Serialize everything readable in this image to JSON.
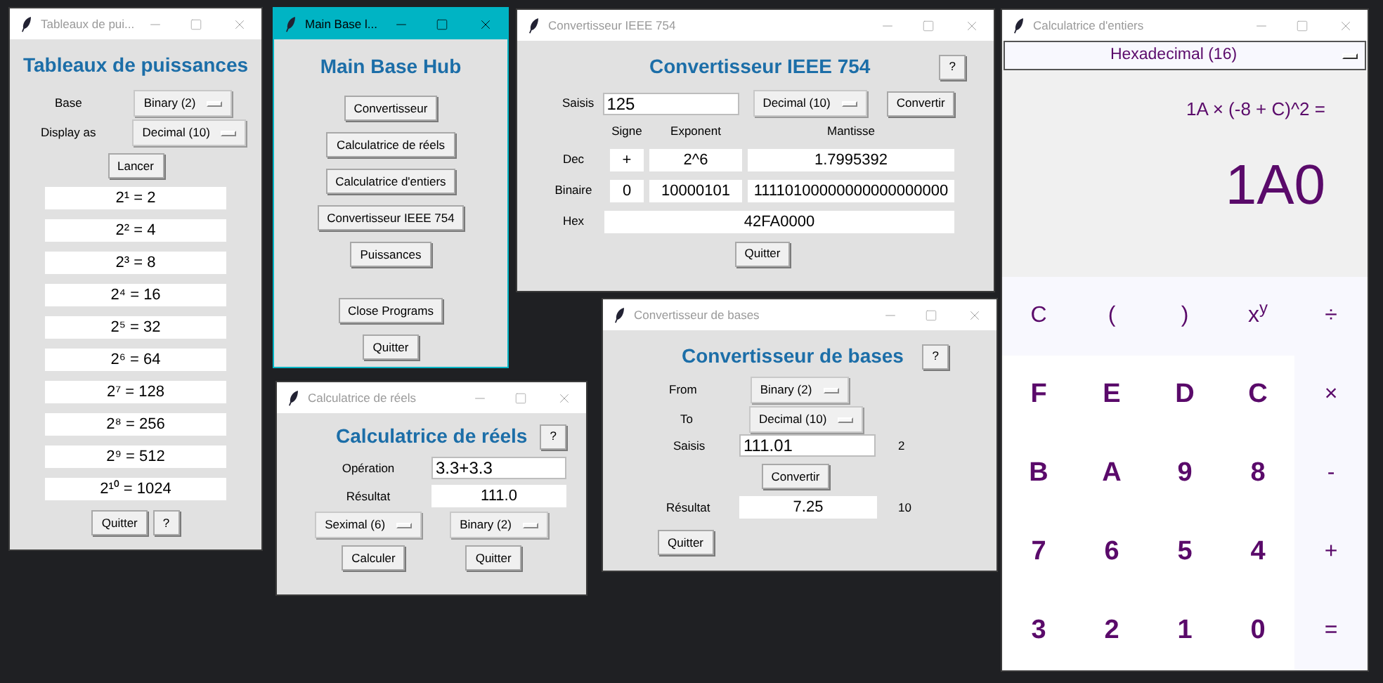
{
  "windows": [
    {
      "kind": "powers",
      "title": "Tableaux de pui...",
      "active": false,
      "heading": "Tableaux de puissances",
      "selectors": [
        {
          "label": "Base",
          "value": "Binary (2)"
        },
        {
          "label": "Display as",
          "value": "Decimal (10)"
        }
      ],
      "run_button": "Lancer",
      "results": [
        "2¹ = 2",
        "2² = 4",
        "2³ = 8",
        "2⁴ = 16",
        "2⁵ = 32",
        "2⁶ = 64",
        "2⁷ = 128",
        "2⁸ = 256",
        "2⁹ = 512",
        "2¹⁰ = 1024"
      ],
      "buttons": [
        "Quitter",
        "?"
      ]
    },
    {
      "kind": "hub",
      "title": "Main Base l...",
      "active": true,
      "heading": "Main Base Hub",
      "buttons": [
        "Convertisseur",
        "Calculatrice de réels",
        "Calculatrice d'entiers",
        "Convertisseur IEEE 754",
        "Puissances"
      ],
      "bottom_buttons": [
        "Close Programs",
        "Quitter"
      ]
    },
    {
      "kind": "reals",
      "title": "Calculatrice de réels",
      "active": false,
      "heading": "Calculatrice de réels",
      "help_button": "?",
      "operation": {
        "label": "Opération",
        "value": "3.3+3.3"
      },
      "result": {
        "label": "Résultat",
        "value": "111.0"
      },
      "selectors": [
        "Seximal (6)",
        "Binary (2)"
      ],
      "buttons": [
        "Calculer",
        "Quitter"
      ]
    },
    {
      "kind": "ieee",
      "title": "Convertisseur IEEE 754",
      "active": false,
      "heading": "Convertisseur IEEE 754",
      "help_button": "?",
      "input": {
        "label": "Saisis",
        "value": "125"
      },
      "selector": "Decimal (10)",
      "convert_button": "Convertir",
      "columns": [
        "Signe",
        "Exponent",
        "Mantisse"
      ],
      "rows": [
        {
          "label": "Dec",
          "cells": [
            "+",
            "2^6",
            "1.7995392"
          ]
        },
        {
          "label": "Binaire",
          "cells": [
            "0",
            "10000101",
            "11110100000000000000000"
          ]
        }
      ],
      "hex": {
        "label": "Hex",
        "value": "42FA0000"
      },
      "quit_button": "Quitter"
    },
    {
      "kind": "bases",
      "title": "Convertisseur de bases",
      "active": false,
      "heading": "Convertisseur de bases",
      "help_button": "?",
      "from": {
        "label": "From",
        "value": "Binary (2)"
      },
      "to": {
        "label": "To",
        "value": "Decimal (10)"
      },
      "input": {
        "label": "Saisis",
        "value": "111.01",
        "base": "2"
      },
      "convert_button": "Convertir",
      "result": {
        "label": "Résultat",
        "value": "7.25",
        "base": "10"
      },
      "quit_button": "Quitter"
    },
    {
      "kind": "integers",
      "title": "Calculatrice d'entiers",
      "active": false,
      "mode": "Hexadecimal (16)",
      "expression": "1A × (-8 + C)^2 =",
      "result": "1A0",
      "keys": [
        {
          "label": "C",
          "kind": "operator"
        },
        {
          "label": "(",
          "kind": "operator"
        },
        {
          "label": ")",
          "kind": "operator"
        },
        {
          "label": "x$^{y}$",
          "kind": "operator"
        },
        {
          "label": "÷",
          "kind": "operator"
        },
        {
          "label": "F",
          "kind": "digit"
        },
        {
          "label": "E",
          "kind": "digit"
        },
        {
          "label": "D",
          "kind": "digit"
        },
        {
          "label": "C",
          "kind": "digit"
        },
        {
          "label": "×",
          "kind": "operator"
        },
        {
          "label": "B",
          "kind": "digit"
        },
        {
          "label": "A",
          "kind": "digit"
        },
        {
          "label": "9",
          "kind": "digit"
        },
        {
          "label": "8",
          "kind": "digit"
        },
        {
          "label": "-",
          "kind": "operator"
        },
        {
          "label": "7",
          "kind": "digit"
        },
        {
          "label": "6",
          "kind": "digit"
        },
        {
          "label": "5",
          "kind": "digit"
        },
        {
          "label": "4",
          "kind": "digit"
        },
        {
          "label": "+",
          "kind": "operator"
        },
        {
          "label": "3",
          "kind": "digit"
        },
        {
          "label": "2",
          "kind": "digit"
        },
        {
          "label": "1",
          "kind": "digit"
        },
        {
          "label": "0",
          "kind": "digit"
        },
        {
          "label": "=",
          "kind": "operator"
        }
      ]
    }
  ]
}
